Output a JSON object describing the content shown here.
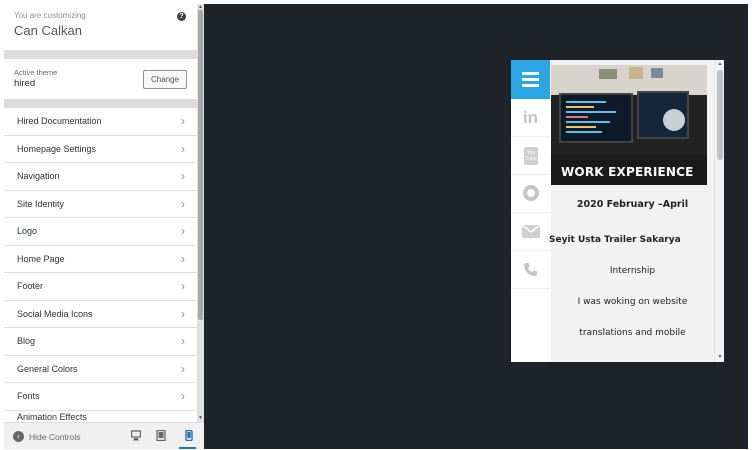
{
  "customizer": {
    "header": {
      "customizing_label": "You are customizing",
      "site_title": "Can Calkan",
      "help_icon": "question-circle-icon"
    },
    "theme": {
      "label": "Active theme",
      "name": "hired",
      "change_button": "Change"
    },
    "sections": [
      "Hired Documentation",
      "Homepage Settings",
      "Navigation",
      "Site Identity",
      "Logo",
      "Home Page",
      "Footer",
      "Social Media Icons",
      "Blog",
      "General Colors",
      "Fonts",
      "Animation Effects"
    ],
    "footer": {
      "hide_controls": "Hide Controls",
      "active_device": "mobile"
    }
  },
  "preview": {
    "accent_color": "#2aa5e5",
    "social_icons": [
      "linkedin-icon",
      "youtube-icon",
      "github-icon",
      "mail-icon",
      "phone-icon"
    ],
    "linkedin_text": "in",
    "youtube_text": "You Tube",
    "hero_title": "WORK EXPERIENCE",
    "date": "2020 February –April",
    "company": "Seyit Usta Trailer Sakarya",
    "role": "Internship",
    "desc_line1": "I was woking on website",
    "desc_line2": "translations and mobile"
  }
}
